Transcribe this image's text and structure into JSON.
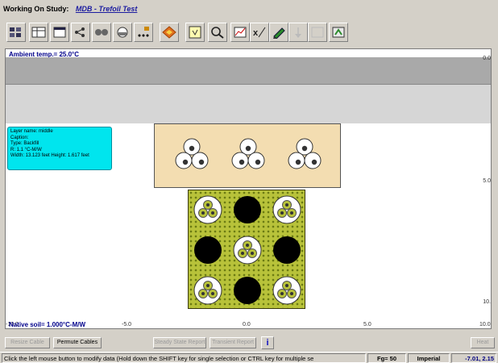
{
  "header": {
    "study_label": "Working On Study:",
    "study_name": "MDB - Trefoil Test"
  },
  "toolbar": {
    "icons": [
      "grid-icon",
      "table-icon",
      "window-icon",
      "tree-icon",
      "cable-icon",
      "duct-icon",
      "more-icon",
      "diamond-icon",
      "note-icon",
      "zoom-icon",
      "chart-icon",
      "xaxis-icon",
      "pencil-icon",
      "arrow-icon",
      "frame-icon",
      "export-icon"
    ]
  },
  "canvas": {
    "ambient_temp": "Ambient temp.= 25.0°C",
    "native_soil": "Native soil= 1.000°C-M/W",
    "y_ticks": [
      "0.0",
      "5.0",
      "10."
    ],
    "x_ticks": [
      "-10.0",
      "-5.0",
      "0.0",
      "5.0",
      "10.0"
    ]
  },
  "layer_tooltip": {
    "layer_name": "Layer name: middle",
    "caption": "Caption:",
    "type": "Type: Backfill",
    "rho": "R: 1.1 °C-M/W",
    "size": "Width: 13.123 feet   Height: 1.617 feet"
  },
  "buttons": {
    "resize_cable": "Resize Cable",
    "permute_cables": "Permute Cables",
    "steady_state_report": "Steady State Report",
    "transient_report": "Transient Report",
    "info": "i",
    "heat": "Heat"
  },
  "status": {
    "message": "Click the left mouse button to modify data (Hold down the SHIFT key for single selection or CTRL key for multiple se",
    "fg": "Fg= 50",
    "units": "Imperial",
    "coords": "-7.01, 2.15"
  },
  "colors": {
    "canvas_bg": "#ffffff",
    "backfill": "#f3ddb1",
    "duct_bank": "#b8c23a",
    "tooltip": "#00e5ee",
    "empty_duct": "#000000"
  }
}
